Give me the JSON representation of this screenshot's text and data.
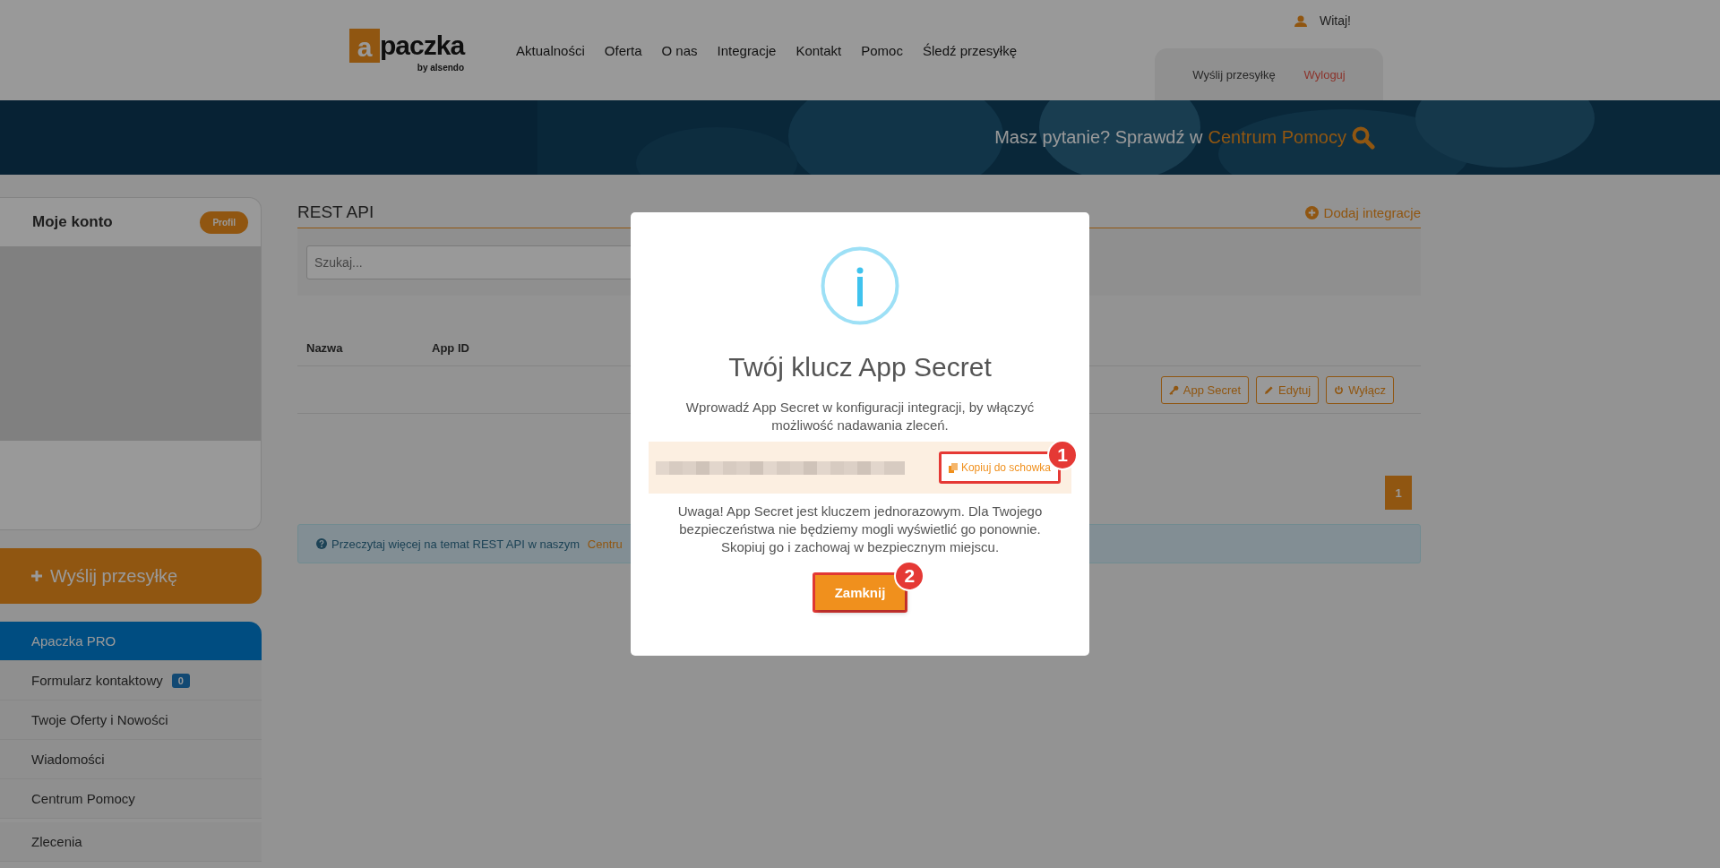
{
  "header": {
    "logo": {
      "mark": "a",
      "name": "paczka",
      "tagline": "by alsendo"
    },
    "nav": [
      "Aktualności",
      "Oferta",
      "O nas",
      "Integracje",
      "Kontakt",
      "Pomoc",
      "Śledź przesyłkę"
    ],
    "greeting": "Witaj!",
    "account_links": [
      {
        "label": "Wyślij przesyłkę",
        "kind": "normal"
      },
      {
        "label": "Wyloguj",
        "kind": "logout"
      }
    ],
    "banner": {
      "question": "Masz pytanie? Sprawdź w",
      "link": "Centrum Pomocy"
    }
  },
  "sidebar": {
    "account": {
      "title": "Moje konto",
      "badge": "Profil"
    },
    "send_button": "Wyślij przesyłkę",
    "menu": [
      {
        "label": "Apaczka PRO",
        "selected": true
      },
      {
        "label": "Formularz kontaktowy",
        "selected": false,
        "count": "0"
      },
      {
        "label": "Twoje Oferty i Nowości",
        "selected": false
      },
      {
        "label": "Wiadomości",
        "selected": false
      },
      {
        "label": "Centrum Pomocy",
        "selected": false
      },
      {
        "label": "Zlecenia",
        "selected": false
      }
    ]
  },
  "content": {
    "title": "REST API",
    "add_link": "Dodaj integracje",
    "search": {
      "placeholder": "Szukaj..."
    },
    "table": {
      "columns": [
        "Nazwa",
        "App ID"
      ],
      "row_actions": [
        {
          "label": "App Secret",
          "kind": "key"
        },
        {
          "label": "Edytuj",
          "kind": "edit"
        },
        {
          "label": "Wyłącz",
          "kind": "power"
        }
      ]
    },
    "pagination": [
      {
        "label": "1",
        "selected": true
      }
    ],
    "info": {
      "text": "Przeczytaj więcej na temat REST API w naszym ",
      "link": "Centru"
    }
  },
  "modal": {
    "title": "Twój klucz App Secret",
    "text": "Wprowadź App Secret w konfiguracji integracji, by włączyć możliwość nadawania zleceń.",
    "copy_button": "Kopiuj do schowka",
    "warning": "Uwaga! App Secret jest kluczem jednorazowym. Dla Twojego bezpieczeństwa nie będziemy mogli wyświetlić go ponownie. Skopiuj go i zachowaj w bezpiecznym miejscu.",
    "close_button": "Zamknij",
    "annotations": [
      "1",
      "2"
    ]
  }
}
